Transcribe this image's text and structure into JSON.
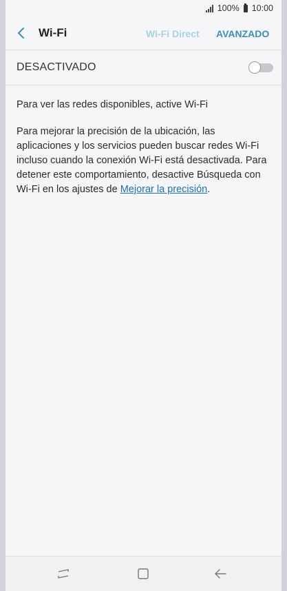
{
  "status_bar": {
    "battery": "100%",
    "time": "10:00",
    "icons": [
      "signal-icon",
      "battery-icon"
    ]
  },
  "app_bar": {
    "title": "Wi-Fi",
    "wifi_direct_label": "Wi-Fi Direct",
    "advanced_label": "AVANZADO",
    "icons": [
      "back-arrow-icon"
    ]
  },
  "wifi_toggle": {
    "label": "DESACTIVADO",
    "state": "off"
  },
  "content": {
    "line1": "Para ver las redes disponibles, active Wi-Fi",
    "para2_text": "Para mejorar la precisión de la ubicación, las aplicaciones y los servicios pueden buscar redes Wi-Fi incluso cuando la conexión Wi-Fi está desactivada. Para detener este comportamiento, desactive Búsqueda con Wi-Fi en los ajustes de ",
    "link_text": "Mejorar la precisión",
    "period": "."
  },
  "nav_bar": {
    "icons": [
      "recent-apps-icon",
      "home-icon",
      "back-icon"
    ]
  },
  "colors": {
    "accent": "#3d8fb0",
    "accent_disabled": "#a9d1df",
    "link": "#1e6fb0",
    "background": "#f6f6f8"
  }
}
